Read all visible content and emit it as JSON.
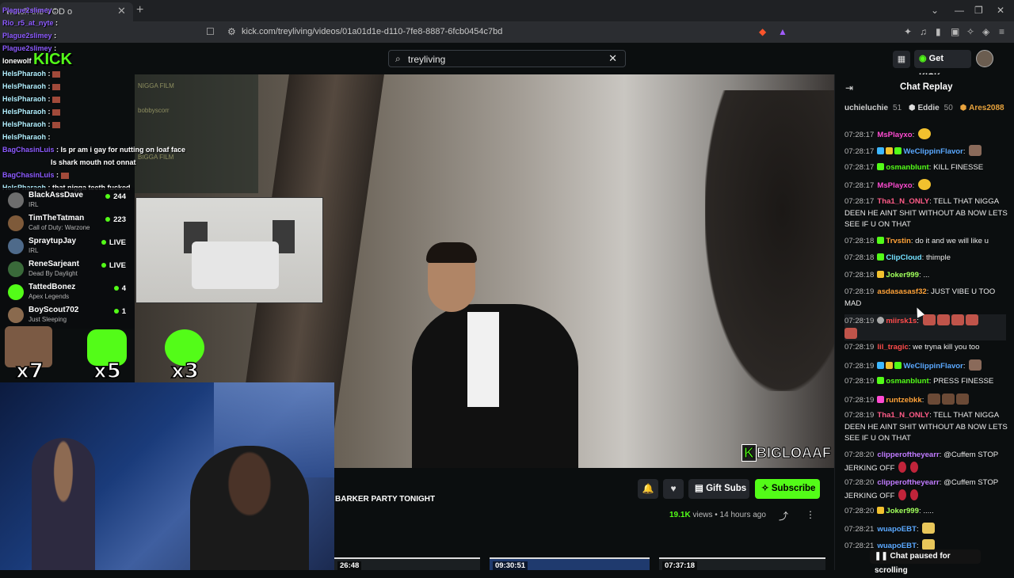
{
  "browser": {
    "tab_title": "watch the VOD o",
    "url": "kick.com/treyliving/videos/01a01d1e-d110-7fe8-8887-6fcb0454c7bd"
  },
  "header": {
    "search_value": "treyliving",
    "get_kicks_label": "Get KICKs"
  },
  "overlay_chat": {
    "lines": [
      {
        "user": "Plague2slimey",
        "text": ":"
      },
      {
        "user": "Rio_r5_at_nyte",
        "text": ":"
      },
      {
        "user": "Plague2slimey",
        "text": ":"
      },
      {
        "user": "Plague2slimey",
        "text": ":"
      },
      {
        "user": "lonewolf",
        "text": ""
      },
      {
        "user": "HelsPharaoh",
        "text": ":"
      },
      {
        "user": "HelsPharaoh",
        "text": ":"
      },
      {
        "user": "HelsPharaoh",
        "text": ":"
      },
      {
        "user": "HelsPharaoh",
        "text": ":"
      },
      {
        "user": "HelsPharaoh",
        "text": ":"
      },
      {
        "user": "HelsPharaoh",
        "text": ":"
      },
      {
        "user": "BagChasinLuis",
        "text": ": Is pr am i gay for nutting on loaf face"
      },
      {
        "user": "",
        "text": "Is shark mouth not onnat"
      },
      {
        "user": "BagChasinLuis",
        "text": ":"
      },
      {
        "user": "HelsPharaoh",
        "text": ": that nigga teeth fucked"
      }
    ],
    "logo": "KICK",
    "faded_lines": [
      "NIGGA FILM",
      "bobbyscorr",
      "BIGGA FILM"
    ]
  },
  "follow_list": [
    {
      "name": "BlackAssDave",
      "category": "IRL",
      "count": "244"
    },
    {
      "name": "TimTheTatman",
      "category": "Call of Duty: Warzone",
      "count": "223"
    },
    {
      "name": "SpraytupJay",
      "category": "IRL",
      "count": "LIVE"
    },
    {
      "name": "ReneSarjeant",
      "category": "Dead By Daylight",
      "count": "LIVE"
    },
    {
      "name": "TattedBonez",
      "category": "Apex Legends",
      "count": "4"
    },
    {
      "name": "BoyScout702",
      "category": "Just Sleeping",
      "count": "1"
    }
  ],
  "combos": [
    "x7",
    "x5",
    "x3"
  ],
  "video": {
    "watermark": "BIGLOAAF"
  },
  "below_video": {
    "title": "BARKER PARTY TONIGHT",
    "gift_subs_label": "Gift Subs",
    "subscribe_label": "Subscribe",
    "views_count": "19.1K",
    "views_label": "views",
    "age": "14 hours ago",
    "thumb_times": [
      "26:48",
      "09:30:51",
      "07:37:18"
    ]
  },
  "chat": {
    "title": "Chat Replay",
    "leaders": [
      {
        "name": "uchieluchie",
        "count": "51"
      },
      {
        "name": "Eddie",
        "count": "50"
      },
      {
        "name": "Ares2088",
        "count": ""
      }
    ],
    "messages": [
      {
        "time": "07:28:17",
        "user": "MsPlayxo",
        "color": "#ff4bd1",
        "text": ""
      },
      {
        "time": "07:28:17",
        "user": "WeClippinFlavor",
        "color": "#5aa8ff",
        "text": ""
      },
      {
        "time": "07:28:17",
        "user": "osmanblunt",
        "color": "#53fc18",
        "text": "KILL FINESSE"
      },
      {
        "time": "07:28:17",
        "user": "MsPlayxo",
        "color": "#ff4bd1",
        "text": ""
      },
      {
        "time": "07:28:17",
        "user": "Tha1_N_ONLY",
        "color": "#ff5b87",
        "text": "TELL THAT NIGGA DEEN HE AINT SHIT WITHOUT AB NOW LETS SEE IF U ON THAT"
      },
      {
        "time": "07:28:18",
        "user": "Trvstin",
        "color": "#ffa238",
        "text": "do it and we will like u"
      },
      {
        "time": "07:28:18",
        "user": "ClipCloud",
        "color": "#73e0ff",
        "text": "thimple"
      },
      {
        "time": "07:28:18",
        "user": "Joker999",
        "color": "#a0ff5b",
        "text": "..."
      },
      {
        "time": "07:28:19",
        "user": "asdasasasf32",
        "color": "#ffa238",
        "text": "JUST VIBE U TOO MAD"
      },
      {
        "time": "07:28:19",
        "user": "miirsk1s",
        "color": "#ff4b4b",
        "text": ""
      },
      {
        "time": "07:28:19",
        "user": "lil_tragic",
        "color": "#ff4b4b",
        "text": "we tryna kill you too"
      },
      {
        "time": "07:28:19",
        "user": "WeClippinFlavor",
        "color": "#5aa8ff",
        "text": ""
      },
      {
        "time": "07:28:19",
        "user": "osmanblunt",
        "color": "#53fc18",
        "text": "PRESS FINESSE"
      },
      {
        "time": "07:28:19",
        "user": "runtzebkk",
        "color": "#ffa238",
        "text": ""
      },
      {
        "time": "07:28:19",
        "user": "Tha1_N_ONLY",
        "color": "#ff5b87",
        "text": "TELL THAT NIGGA DEEN HE AINT SHIT WITHOUT AB NOW LETS SEE IF U ON THAT"
      },
      {
        "time": "07:28:20",
        "user": "clipperoftheyearr",
        "color": "#c07bff",
        "text": "@Cuffem STOP JERKING OFF"
      },
      {
        "time": "07:28:20",
        "user": "clipperoftheyearr",
        "color": "#c07bff",
        "text": "@Cuffem STOP JERKING OFF"
      },
      {
        "time": "07:28:20",
        "user": "Joker999",
        "color": "#a0ff5b",
        "text": "....."
      },
      {
        "time": "07:28:21",
        "user": "wuapoEBT",
        "color": "#5aa8ff",
        "text": ""
      },
      {
        "time": "07:28:21",
        "user": "wuapoEBT",
        "color": "#5aa8ff",
        "text": ""
      }
    ],
    "paused_label": "Chat paused for scrolling"
  }
}
